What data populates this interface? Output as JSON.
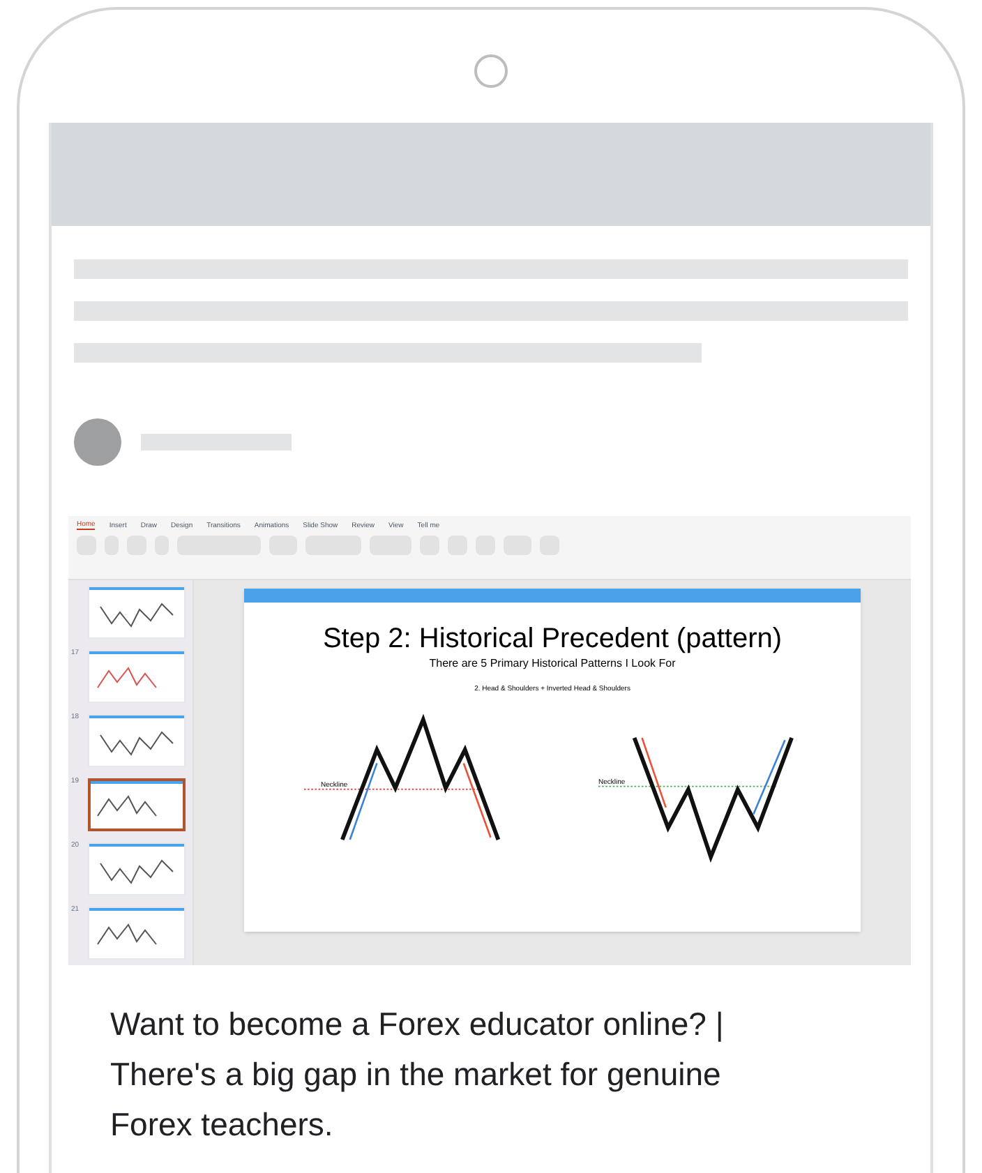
{
  "screenshot": {
    "ribbon_tabs": [
      {
        "label": "Home",
        "selected": true
      },
      {
        "label": "Insert",
        "selected": false
      },
      {
        "label": "Draw",
        "selected": false
      },
      {
        "label": "Design",
        "selected": false
      },
      {
        "label": "Transitions",
        "selected": false
      },
      {
        "label": "Animations",
        "selected": false
      },
      {
        "label": "Slide Show",
        "selected": false
      },
      {
        "label": "Review",
        "selected": false
      },
      {
        "label": "View",
        "selected": false
      },
      {
        "label": "Tell me",
        "selected": false
      }
    ],
    "thumbnails": [
      {
        "selected": false
      },
      {
        "number": "17",
        "selected": false
      },
      {
        "number": "18",
        "selected": false
      },
      {
        "number": "19",
        "selected": true
      },
      {
        "number": "20",
        "selected": false
      },
      {
        "number": "21",
        "selected": false
      }
    ],
    "slide": {
      "title": "Step 2: Historical Precedent (pattern)",
      "subtitle": "There are 5 Primary Historical Patterns I Look For",
      "pattern_label": "2. Head & Shoulders + Inverted Head & Shoulders",
      "necklines": [
        "Neckline",
        "Neckline"
      ]
    }
  },
  "post_title": "Want to become a Forex educator online? | There's a big gap in the market for genuine Forex teachers."
}
